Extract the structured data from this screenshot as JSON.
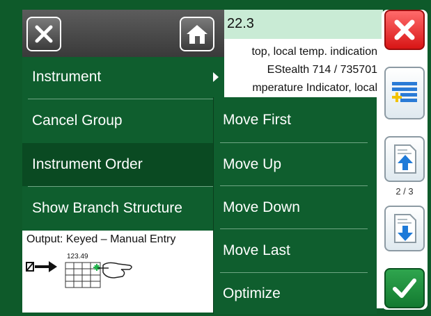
{
  "record": {
    "value": "22.3",
    "lines": [
      "top, local temp. indication",
      "EStealth 714 / 735701",
      "mperature Indicator, local"
    ]
  },
  "menu": {
    "items": [
      {
        "label": "Instrument",
        "has_submenu": true
      },
      {
        "label": "Cancel Group"
      },
      {
        "label": "Instrument Order",
        "selected": true
      },
      {
        "label": "Show Branch Structure"
      }
    ],
    "info": {
      "text": "Output: Keyed – Manual Entry",
      "keypad_number": "123.49"
    }
  },
  "submenu": {
    "items": [
      {
        "label": "Move First"
      },
      {
        "label": "Move Up"
      },
      {
        "label": "Move Down"
      },
      {
        "label": "Move Last"
      },
      {
        "label": "Optimize"
      }
    ]
  },
  "toolbar": {
    "page_indicator": "2 / 3"
  },
  "icons": {
    "close": "close-icon",
    "home": "home-icon",
    "cancel": "red-x-icon",
    "list": "list-add-icon",
    "up": "page-up-icon",
    "down": "page-down-icon",
    "ok": "checkmark-icon"
  },
  "colors": {
    "menu_bg": "#0f5e2e",
    "selected_bg": "#0a4a22",
    "header_green": "#c9ebd5",
    "cancel_red": "#d81515",
    "ok_green": "#137a30"
  }
}
